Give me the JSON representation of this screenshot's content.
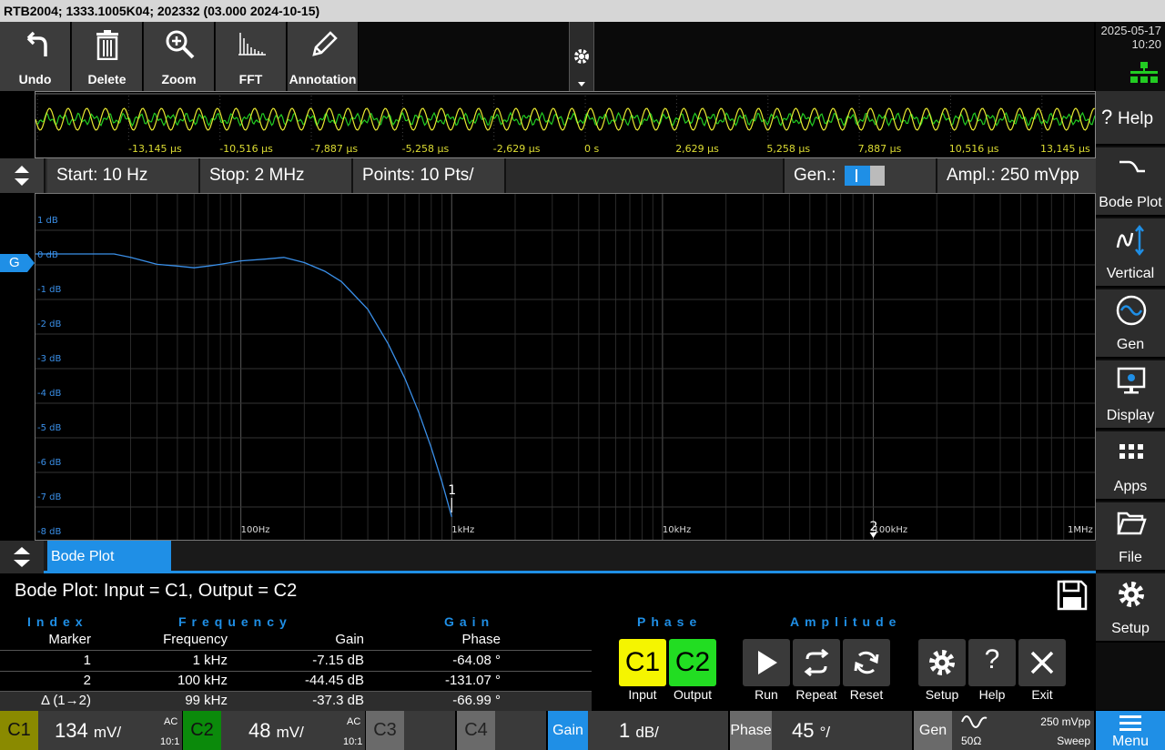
{
  "title": "RTB2004; 1333.1005K04; 202332 (03.000 2024-10-15)",
  "toolbar": {
    "undo": "Undo",
    "delete": "Delete",
    "zoom": "Zoom",
    "fft": "FFT",
    "annotation": "Annotation"
  },
  "clock": {
    "date": "2025-05-17",
    "time": "10:20"
  },
  "sidebar": {
    "help": "Help",
    "bode": "Bode Plot",
    "vertical": "Vertical",
    "gen": "Gen",
    "display": "Display",
    "apps": "Apps",
    "file": "File",
    "setup": "Setup",
    "menu": "Menu"
  },
  "overview": {
    "time_labels": [
      "-13,145 µs",
      "-10,516 µs",
      "-7,887 µs",
      "-5,258 µs",
      "-2,629 µs",
      "0 s",
      "2,629 µs",
      "5,258 µs",
      "7,887 µs",
      "10,516 µs",
      "13,145 µs"
    ]
  },
  "params": {
    "start": "Start: 10 Hz",
    "stop": "Stop: 2 MHz",
    "points": "Points: 10 Pts/",
    "gen": "Gen.:",
    "ampl": "Ampl.: 250 mVpp"
  },
  "chart_data": {
    "type": "line",
    "title": "",
    "xlabel": "",
    "ylabel": "",
    "x_scale": "log",
    "xlim": [
      10,
      1000000
    ],
    "ylim": [
      -8,
      2
    ],
    "y_tick_labels": [
      "1 dB",
      "0 dB",
      "-1 dB",
      "-2 dB",
      "-3 dB",
      "-4 dB",
      "-5 dB",
      "-6 dB",
      "-7 dB",
      "-8 dB"
    ],
    "x_tick_labels": [
      "100Hz",
      "1kHz",
      "10kHz",
      "100kHz",
      "1MHz"
    ],
    "grid": true,
    "line_color": "#3a8fe8",
    "series": [
      {
        "x": [
          10,
          25,
          30,
          40,
          50,
          60,
          70,
          80,
          100,
          130,
          160,
          200,
          250,
          300,
          400,
          500,
          600,
          700,
          800,
          900,
          1000
        ],
        "y": [
          0,
          0,
          -0.1,
          -0.3,
          -0.35,
          -0.4,
          -0.35,
          -0.3,
          -0.2,
          -0.15,
          -0.1,
          -0.25,
          -0.5,
          -0.8,
          -1.6,
          -2.6,
          -3.6,
          -4.6,
          -5.6,
          -6.6,
          -7.6
        ]
      }
    ],
    "markers": [
      {
        "label": "1",
        "x": 1000
      },
      {
        "label": "2",
        "x": 100000
      }
    ]
  },
  "g_marker": "G",
  "tab": {
    "label": "Bode Plot"
  },
  "results": {
    "title": "Bode Plot: Input = C1, Output = C2",
    "header1": [
      "Index",
      "Frequency",
      "Gain",
      "Phase",
      "Amplitude"
    ],
    "header2": [
      "Marker",
      "Frequency",
      "Gain",
      "Phase"
    ],
    "rows": [
      {
        "marker": "1",
        "freq": "1 kHz",
        "gain": "-7.15 dB",
        "phase": "-64.08 °"
      },
      {
        "marker": "2",
        "freq": "100 kHz",
        "gain": "-44.45 dB",
        "phase": "-131.07 °"
      },
      {
        "marker": "Δ (1→2)",
        "freq": "99 kHz",
        "gain": "-37.3 dB",
        "phase": "-66.99 °"
      }
    ],
    "phase_section": "Phase",
    "amplitude_section": "Amplitude",
    "c1": "C1",
    "c1_label": "Input",
    "c2": "C2",
    "c2_label": "Output",
    "run": "Run",
    "repeat": "Repeat",
    "reset": "Reset",
    "setup": "Setup",
    "help": "Help",
    "exit": "Exit",
    "help_glyph": "?"
  },
  "bottom": {
    "c1": "C1",
    "c1_val": "134",
    "c1_unit": "mV/",
    "c1_ac": "AC",
    "c1_ratio": "10:1",
    "c2": "C2",
    "c2_val": "48",
    "c2_unit": "mV/",
    "c2_ac": "AC",
    "c2_ratio": "10:1",
    "c3": "C3",
    "c4": "C4",
    "gain": "Gain",
    "gain_val": "1",
    "gain_unit": "dB/",
    "phase": "Phase",
    "phase_val": "45",
    "phase_unit": "°/",
    "gen": "Gen",
    "gen_imp": "50Ω",
    "gen_ampl": "250 mVpp",
    "gen_mode": "Sweep"
  },
  "colors": {
    "accent": "#1f8fe6",
    "c1": "#f5f500",
    "c2": "#22dd22"
  }
}
